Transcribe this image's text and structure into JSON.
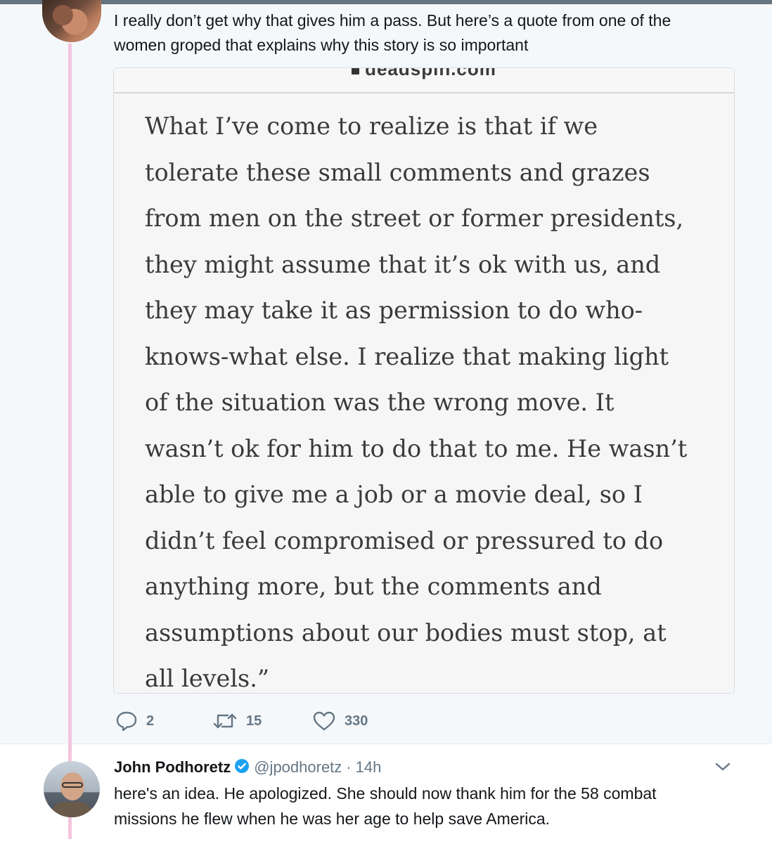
{
  "tweet1": {
    "text_lines": [
      "I really don’t get why that gives him a pass. But here’s a quote from one of the",
      "women groped that explains why this story is so important"
    ],
    "screenshot": {
      "domain": "deadspin.com",
      "quote_lines": [
        "What I’ve come to realize is that if we",
        "tolerate these small comments and grazes",
        "from men on the street or former presidents,",
        "they might assume that it’s ok with us, and",
        "they may take it as permission to do who-",
        "knows-what else. I realize that making light",
        "of the situation was the wrong move. It",
        "wasn’t ok for him to do that to me. He wasn’t",
        "able to give me a job or a movie deal, so I",
        "didn’t feel compromised or pressured to do",
        "anything more, but the comments and",
        "assumptions about our bodies must stop, at",
        "all levels.”"
      ]
    },
    "actions": {
      "reply_count": "2",
      "retweet_count": "15",
      "like_count": "330"
    }
  },
  "tweet2": {
    "name": "John Podhoretz",
    "handle": "@jpodhoretz",
    "separator": "·",
    "time": "14h",
    "text_lines": [
      "here's an idea. He apologized. She should now thank him for the 58 combat",
      "missions he flew when he was her age to help save America."
    ]
  },
  "colors": {
    "thread_line": "#f3c4dd",
    "icon_gray": "#657786",
    "verified_blue": "#1da1f2",
    "page_bg": "#f5f8fa"
  },
  "icons": [
    "reply-icon",
    "retweet-icon",
    "like-icon",
    "verified-icon",
    "chevron-down-icon"
  ]
}
